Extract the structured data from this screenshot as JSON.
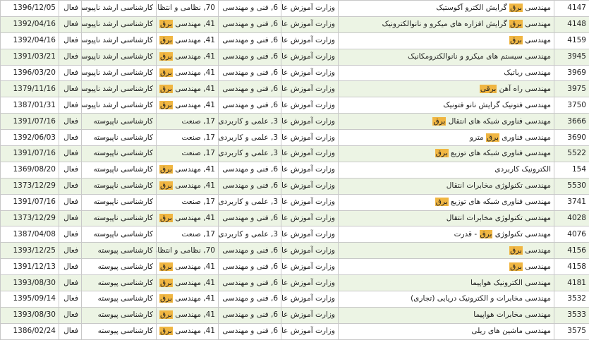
{
  "rows": [
    {
      "code": "4147",
      "field": [
        {
          "t": "مهندسی "
        },
        {
          "t": "برق",
          "hl": true
        },
        {
          "t": " گرایش الکترو آکوستیک"
        }
      ],
      "org": "وزارت آموزش عالی",
      "group": "6, فنی و مهندسی",
      "sub": [
        {
          "t": "70, نظامی و انتظامی"
        }
      ],
      "level": "کارشناسی ارشد ناپیوسته",
      "status": "فعال",
      "date": "1396/12/05"
    },
    {
      "code": "4148",
      "field": [
        {
          "t": "مهندسی "
        },
        {
          "t": "برق",
          "hl": true
        },
        {
          "t": " گرایش افزاره های میکرو و نانوالکترونیک"
        }
      ],
      "org": "وزارت آموزش عالی",
      "group": "6, فنی و مهندسی",
      "sub": [
        {
          "t": "41, مهندسی "
        },
        {
          "t": "برق",
          "hl": true
        }
      ],
      "level": "کارشناسی ارشد ناپیوسته",
      "status": "فعال",
      "date": "1392/04/16"
    },
    {
      "code": "4159",
      "field": [
        {
          "t": "مهندسی "
        },
        {
          "t": "برق",
          "hl": true
        }
      ],
      "org": "وزارت آموزش عالی",
      "group": "6, فنی و مهندسی",
      "sub": [
        {
          "t": "41, مهندسی "
        },
        {
          "t": "برق",
          "hl": true
        }
      ],
      "level": "کارشناسی ارشد ناپیوسته",
      "status": "فعال",
      "date": "1392/04/16"
    },
    {
      "code": "3945",
      "field": [
        {
          "t": "مهندسی سیستم های میکرو و نانوالکترومکانیک"
        }
      ],
      "org": "وزارت آموزش عالی",
      "group": "6, فنی و مهندسی",
      "sub": [
        {
          "t": "41, مهندسی "
        },
        {
          "t": "برق",
          "hl": true
        }
      ],
      "level": "کارشناسی ارشد ناپیوسته",
      "status": "فعال",
      "date": "1391/03/21"
    },
    {
      "code": "3969",
      "field": [
        {
          "t": "مهندسی رباتیک"
        }
      ],
      "org": "وزارت آموزش عالی",
      "group": "6, فنی و مهندسی",
      "sub": [
        {
          "t": "41, مهندسی "
        },
        {
          "t": "برق",
          "hl": true
        }
      ],
      "level": "کارشناسی ارشد ناپیوسته",
      "status": "فعال",
      "date": "1396/03/20"
    },
    {
      "code": "3975",
      "field": [
        {
          "t": "مهندسی راه آهن "
        },
        {
          "t": "برقی",
          "hl": true
        }
      ],
      "org": "وزارت آموزش عالی",
      "group": "6, فنی و مهندسی",
      "sub": [
        {
          "t": "41, مهندسی "
        },
        {
          "t": "برق",
          "hl": true
        }
      ],
      "level": "کارشناسی ارشد ناپیوسته",
      "status": "فعال",
      "date": "1379/11/16"
    },
    {
      "code": "3750",
      "field": [
        {
          "t": "مهندسی فتونیک گرایش نانو فتونیک"
        }
      ],
      "org": "وزارت آموزش عالی",
      "group": "6, فنی و مهندسی",
      "sub": [
        {
          "t": "41, مهندسی "
        },
        {
          "t": "برق",
          "hl": true
        }
      ],
      "level": "کارشناسی ارشد ناپیوسته",
      "status": "فعال",
      "date": "1387/01/31"
    },
    {
      "code": "3666",
      "field": [
        {
          "t": "مهندسی فناوری شبکه های انتقال "
        },
        {
          "t": "برق",
          "hl": true
        }
      ],
      "org": "وزارت آموزش عالی",
      "group": "3, علمی و کاربردی",
      "sub": [
        {
          "t": "17, صنعت"
        }
      ],
      "level": "کارشناسی ناپیوسته",
      "status": "فعال",
      "date": "1391/07/16"
    },
    {
      "code": "3690",
      "field": [
        {
          "t": "مهندسی فناوری "
        },
        {
          "t": "برق",
          "hl": true
        },
        {
          "t": " مترو"
        }
      ],
      "org": "وزارت آموزش عالی",
      "group": "3, علمی و کاربردی",
      "sub": [
        {
          "t": "17, صنعت"
        }
      ],
      "level": "کارشناسی ناپیوسته",
      "status": "فعال",
      "date": "1392/06/03"
    },
    {
      "code": "5522",
      "field": [
        {
          "t": "مهندسی فناوری شبکه های توزیع "
        },
        {
          "t": "برق",
          "hl": true
        }
      ],
      "org": "وزارت آموزش عالی",
      "group": "3, علمی و کاربردی",
      "sub": [
        {
          "t": "17, صنعت"
        }
      ],
      "level": "کارشناسی ناپیوسته",
      "status": "فعال",
      "date": "1391/07/16"
    },
    {
      "code": "154",
      "field": [
        {
          "t": "الکترونیک کاربردی"
        }
      ],
      "org": "وزارت آموزش عالی",
      "group": "6, فنی و مهندسی",
      "sub": [
        {
          "t": "41, مهندسی "
        },
        {
          "t": "برق",
          "hl": true
        }
      ],
      "level": "کارشناسی ناپیوسته",
      "status": "فعال",
      "date": "1369/08/20"
    },
    {
      "code": "5530",
      "field": [
        {
          "t": "مهندسی تکنولوژی مخابرات انتقال"
        }
      ],
      "org": "وزارت آموزش عالی",
      "group": "6, فنی و مهندسی",
      "sub": [
        {
          "t": "41, مهندسی "
        },
        {
          "t": "برق",
          "hl": true
        }
      ],
      "level": "کارشناسی ناپیوسته",
      "status": "فعال",
      "date": "1373/12/29"
    },
    {
      "code": "3741",
      "field": [
        {
          "t": "مهندسی فناوری شبکه های توزیع "
        },
        {
          "t": "برق",
          "hl": true
        }
      ],
      "org": "وزارت آموزش عالی",
      "group": "3, علمی و کاربردی",
      "sub": [
        {
          "t": "17, صنعت"
        }
      ],
      "level": "کارشناسی ناپیوسته",
      "status": "فعال",
      "date": "1391/07/16"
    },
    {
      "code": "4028",
      "field": [
        {
          "t": "مهندسی تکنولوژی مخابرات انتقال"
        }
      ],
      "org": "وزارت آموزش عالی",
      "group": "6, فنی و مهندسی",
      "sub": [
        {
          "t": "41, مهندسی "
        },
        {
          "t": "برق",
          "hl": true
        }
      ],
      "level": "کارشناسی ناپیوسته",
      "status": "فعال",
      "date": "1373/12/29"
    },
    {
      "code": "4076",
      "field": [
        {
          "t": "مهندسی تکنولوژی "
        },
        {
          "t": "برق",
          "hl": true
        },
        {
          "t": " - قدرت"
        }
      ],
      "org": "وزارت آموزش عالی",
      "group": "3, علمی و کاربردی",
      "sub": [
        {
          "t": "17, صنعت"
        }
      ],
      "level": "کارشناسی ناپیوسته",
      "status": "فعال",
      "date": "1387/04/08"
    },
    {
      "code": "4156",
      "field": [
        {
          "t": "مهندسی "
        },
        {
          "t": "برق",
          "hl": true
        }
      ],
      "org": "وزارت آموزش عالی",
      "group": "6, فنی و مهندسی",
      "sub": [
        {
          "t": "70, نظامی و انتظامی"
        }
      ],
      "level": "کارشناسی پیوسته",
      "status": "فعال",
      "date": "1393/12/25"
    },
    {
      "code": "4158",
      "field": [
        {
          "t": "مهندسی "
        },
        {
          "t": "برق",
          "hl": true
        }
      ],
      "org": "وزارت آموزش عالی",
      "group": "6, فنی و مهندسی",
      "sub": [
        {
          "t": "41, مهندسی "
        },
        {
          "t": "برق",
          "hl": true
        }
      ],
      "level": "کارشناسی پیوسته",
      "status": "فعال",
      "date": "1391/12/13"
    },
    {
      "code": "4181",
      "field": [
        {
          "t": "مهندسی الکترونیک هواپیما"
        }
      ],
      "org": "وزارت آموزش عالی",
      "group": "6, فنی و مهندسی",
      "sub": [
        {
          "t": "41, مهندسی "
        },
        {
          "t": "برق",
          "hl": true
        }
      ],
      "level": "کارشناسی پیوسته",
      "status": "فعال",
      "date": "1393/08/30"
    },
    {
      "code": "3532",
      "field": [
        {
          "t": "مهندسی مخابرات و الکترونیک دریایی (تجاری)"
        }
      ],
      "org": "وزارت آموزش عالی",
      "group": "6, فنی و مهندسی",
      "sub": [
        {
          "t": "41, مهندسی "
        },
        {
          "t": "برق",
          "hl": true
        }
      ],
      "level": "کارشناسی پیوسته",
      "status": "فعال",
      "date": "1395/09/14"
    },
    {
      "code": "3533",
      "field": [
        {
          "t": "مهندسی مخابرات هواپیما"
        }
      ],
      "org": "وزارت آموزش عالی",
      "group": "6, فنی و مهندسی",
      "sub": [
        {
          "t": "41, مهندسی "
        },
        {
          "t": "برق",
          "hl": true
        }
      ],
      "level": "کارشناسی پیوسته",
      "status": "فعال",
      "date": "1393/08/30"
    },
    {
      "code": "3575",
      "field": [
        {
          "t": "مهندسی ماشین های ریلی"
        }
      ],
      "org": "وزارت آموزش عالی",
      "group": "6, فنی و مهندسی",
      "sub": [
        {
          "t": "41, مهندسی "
        },
        {
          "t": "برق",
          "hl": true
        }
      ],
      "level": "کارشناسی پیوسته",
      "status": "فعال",
      "date": "1386/02/24"
    }
  ]
}
